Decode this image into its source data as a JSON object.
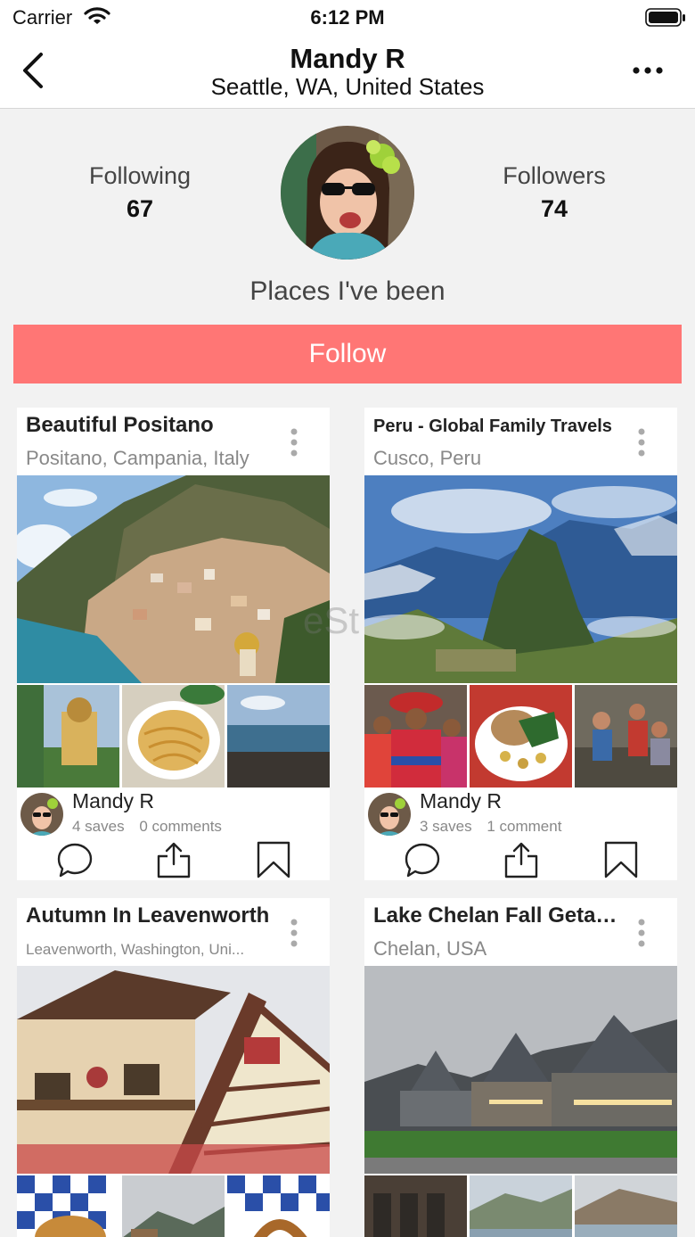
{
  "status": {
    "carrier": "Carrier",
    "time": "6:12 PM"
  },
  "nav": {
    "title": "Mandy R",
    "subtitle": "Seattle, WA, United States"
  },
  "profile": {
    "following_label": "Following",
    "following_count": "67",
    "followers_label": "Followers",
    "followers_count": "74",
    "section_title": "Places I've been",
    "follow_label": "Follow"
  },
  "watermark": "eSt",
  "colors": {
    "accent": "#ff7675",
    "background": "#f2f2f2",
    "muted": "#888888"
  },
  "cards": [
    {
      "title": "Beautiful Positano",
      "location": "Positano, Campania, Italy",
      "user": "Mandy R",
      "saves": "4 saves",
      "comments": "0 comments"
    },
    {
      "title": "Peru - Global Family Travels",
      "location": "Cusco, Peru",
      "user": "Mandy R",
      "saves": "3 saves",
      "comments": "1 comment"
    },
    {
      "title": "Autumn In Leavenworth",
      "location": "Leavenworth, Washington, Uni..."
    },
    {
      "title": "Lake Chelan Fall Getaway",
      "location": "Chelan,  USA"
    }
  ]
}
